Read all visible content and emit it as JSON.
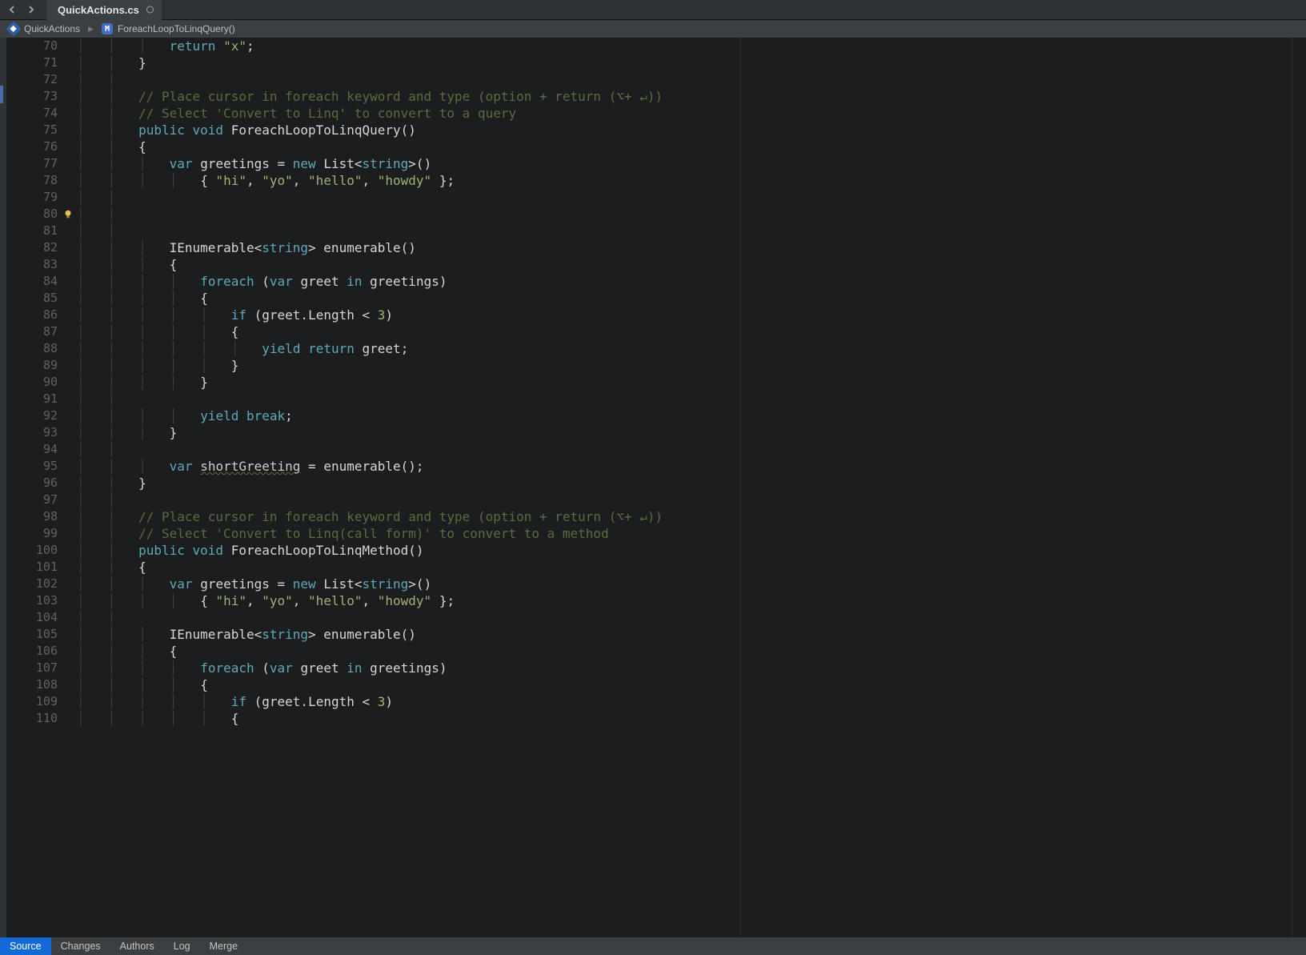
{
  "tab": {
    "title": "QuickActions.cs"
  },
  "breadcrumb": {
    "class": "QuickActions",
    "method": "ForeachLoopToLinqQuery()"
  },
  "lines": [
    {
      "n": 70,
      "indent": 12,
      "tokens": [
        [
          "kw",
          "return"
        ],
        [
          "punct",
          " "
        ],
        [
          "str",
          "\"x\""
        ],
        [
          "punct",
          ";"
        ]
      ]
    },
    {
      "n": 71,
      "indent": 8,
      "tokens": [
        [
          "punct",
          "}"
        ]
      ]
    },
    {
      "n": 72,
      "indent": 0,
      "tokens": []
    },
    {
      "n": 73,
      "indent": 8,
      "tokens": [
        [
          "cmt",
          "// Place cursor in foreach keyword and type (option + return (⌥+ ↵))"
        ]
      ]
    },
    {
      "n": 74,
      "indent": 8,
      "tokens": [
        [
          "cmt",
          "// Select 'Convert to Linq' to convert to a query"
        ]
      ]
    },
    {
      "n": 75,
      "indent": 8,
      "tokens": [
        [
          "kw",
          "public"
        ],
        [
          "punct",
          " "
        ],
        [
          "kw",
          "void"
        ],
        [
          "punct",
          " "
        ],
        [
          "method",
          "ForeachLoopToLinqQuery"
        ],
        [
          "punct",
          "()"
        ]
      ]
    },
    {
      "n": 76,
      "indent": 8,
      "tokens": [
        [
          "punct",
          "{"
        ]
      ]
    },
    {
      "n": 77,
      "indent": 12,
      "tokens": [
        [
          "kw",
          "var"
        ],
        [
          "punct",
          " "
        ],
        [
          "ident",
          "greetings = "
        ],
        [
          "kw",
          "new"
        ],
        [
          "punct",
          " "
        ],
        [
          "type",
          "List<"
        ],
        [
          "kw",
          "string"
        ],
        [
          "punct",
          ">()"
        ]
      ]
    },
    {
      "n": 78,
      "indent": 16,
      "tokens": [
        [
          "punct",
          "{ "
        ],
        [
          "str",
          "\"hi\""
        ],
        [
          "punct",
          ", "
        ],
        [
          "str",
          "\"yo\""
        ],
        [
          "punct",
          ", "
        ],
        [
          "str",
          "\"hello\""
        ],
        [
          "punct",
          ", "
        ],
        [
          "str",
          "\"howdy\""
        ],
        [
          "punct",
          " };"
        ]
      ]
    },
    {
      "n": 79,
      "indent": 0,
      "tokens": []
    },
    {
      "n": 80,
      "indent": 0,
      "tokens": [],
      "bulb": true
    },
    {
      "n": 81,
      "indent": 0,
      "tokens": []
    },
    {
      "n": 82,
      "indent": 12,
      "tokens": [
        [
          "type",
          "IEnumerable<"
        ],
        [
          "kw",
          "string"
        ],
        [
          "punct",
          "> "
        ],
        [
          "method",
          "enumerable"
        ],
        [
          "punct",
          "()"
        ]
      ]
    },
    {
      "n": 83,
      "indent": 12,
      "tokens": [
        [
          "punct",
          "{"
        ]
      ]
    },
    {
      "n": 84,
      "indent": 16,
      "tokens": [
        [
          "kw",
          "foreach"
        ],
        [
          "punct",
          " ("
        ],
        [
          "kw",
          "var"
        ],
        [
          "punct",
          " "
        ],
        [
          "ident",
          "greet "
        ],
        [
          "kw",
          "in"
        ],
        [
          "punct",
          " "
        ],
        [
          "ident",
          "greetings)"
        ]
      ]
    },
    {
      "n": 85,
      "indent": 16,
      "tokens": [
        [
          "punct",
          "{"
        ]
      ]
    },
    {
      "n": 86,
      "indent": 20,
      "tokens": [
        [
          "kw",
          "if"
        ],
        [
          "punct",
          " (greet.Length < "
        ],
        [
          "num",
          "3"
        ],
        [
          "punct",
          ")"
        ]
      ]
    },
    {
      "n": 87,
      "indent": 20,
      "tokens": [
        [
          "punct",
          "{"
        ]
      ]
    },
    {
      "n": 88,
      "indent": 24,
      "tokens": [
        [
          "kw",
          "yield"
        ],
        [
          "punct",
          " "
        ],
        [
          "kw",
          "return"
        ],
        [
          "punct",
          " greet;"
        ]
      ]
    },
    {
      "n": 89,
      "indent": 20,
      "tokens": [
        [
          "punct",
          "}"
        ]
      ]
    },
    {
      "n": 90,
      "indent": 16,
      "tokens": [
        [
          "punct",
          "}"
        ]
      ]
    },
    {
      "n": 91,
      "indent": 0,
      "tokens": []
    },
    {
      "n": 92,
      "indent": 16,
      "tokens": [
        [
          "kw",
          "yield"
        ],
        [
          "punct",
          " "
        ],
        [
          "kw",
          "break"
        ],
        [
          "punct",
          ";"
        ]
      ]
    },
    {
      "n": 93,
      "indent": 12,
      "tokens": [
        [
          "punct",
          "}"
        ]
      ]
    },
    {
      "n": 94,
      "indent": 0,
      "tokens": []
    },
    {
      "n": 95,
      "indent": 12,
      "tokens": [
        [
          "kw",
          "var"
        ],
        [
          "punct",
          " "
        ],
        [
          "underline",
          "shortGreeting"
        ],
        [
          "punct",
          " = enumerable();"
        ]
      ]
    },
    {
      "n": 96,
      "indent": 8,
      "tokens": [
        [
          "punct",
          "}"
        ]
      ]
    },
    {
      "n": 97,
      "indent": 0,
      "tokens": []
    },
    {
      "n": 98,
      "indent": 8,
      "tokens": [
        [
          "cmt",
          "// Place cursor in foreach keyword and type (option + return (⌥+ ↵))"
        ]
      ]
    },
    {
      "n": 99,
      "indent": 8,
      "tokens": [
        [
          "cmt",
          "// Select 'Convert to Linq(call form)' to convert to a method"
        ]
      ]
    },
    {
      "n": 100,
      "indent": 8,
      "tokens": [
        [
          "kw",
          "public"
        ],
        [
          "punct",
          " "
        ],
        [
          "kw",
          "void"
        ],
        [
          "punct",
          " "
        ],
        [
          "method",
          "ForeachLoopToLinqMethod"
        ],
        [
          "punct",
          "()"
        ]
      ]
    },
    {
      "n": 101,
      "indent": 8,
      "tokens": [
        [
          "punct",
          "{"
        ]
      ]
    },
    {
      "n": 102,
      "indent": 12,
      "tokens": [
        [
          "kw",
          "var"
        ],
        [
          "punct",
          " "
        ],
        [
          "ident",
          "greetings = "
        ],
        [
          "kw",
          "new"
        ],
        [
          "punct",
          " "
        ],
        [
          "type",
          "List<"
        ],
        [
          "kw",
          "string"
        ],
        [
          "punct",
          ">()"
        ]
      ]
    },
    {
      "n": 103,
      "indent": 16,
      "tokens": [
        [
          "punct",
          "{ "
        ],
        [
          "str",
          "\"hi\""
        ],
        [
          "punct",
          ", "
        ],
        [
          "str",
          "\"yo\""
        ],
        [
          "punct",
          ", "
        ],
        [
          "str",
          "\"hello\""
        ],
        [
          "punct",
          ", "
        ],
        [
          "str",
          "\"howdy\""
        ],
        [
          "punct",
          " };"
        ]
      ]
    },
    {
      "n": 104,
      "indent": 0,
      "tokens": []
    },
    {
      "n": 105,
      "indent": 12,
      "tokens": [
        [
          "type",
          "IEnumerable<"
        ],
        [
          "kw",
          "string"
        ],
        [
          "punct",
          "> "
        ],
        [
          "method",
          "enumerable"
        ],
        [
          "punct",
          "()"
        ]
      ]
    },
    {
      "n": 106,
      "indent": 12,
      "tokens": [
        [
          "punct",
          "{"
        ]
      ]
    },
    {
      "n": 107,
      "indent": 16,
      "tokens": [
        [
          "kw",
          "foreach"
        ],
        [
          "punct",
          " ("
        ],
        [
          "kw",
          "var"
        ],
        [
          "punct",
          " "
        ],
        [
          "ident",
          "greet "
        ],
        [
          "kw",
          "in"
        ],
        [
          "punct",
          " "
        ],
        [
          "ident",
          "greetings)"
        ]
      ]
    },
    {
      "n": 108,
      "indent": 16,
      "tokens": [
        [
          "punct",
          "{"
        ]
      ]
    },
    {
      "n": 109,
      "indent": 20,
      "tokens": [
        [
          "kw",
          "if"
        ],
        [
          "punct",
          " (greet.Length < "
        ],
        [
          "num",
          "3"
        ],
        [
          "punct",
          ")"
        ]
      ]
    },
    {
      "n": 110,
      "indent": 20,
      "tokens": [
        [
          "punct",
          "{"
        ]
      ]
    }
  ],
  "bottom_tabs": [
    "Source",
    "Changes",
    "Authors",
    "Log",
    "Merge"
  ],
  "active_bottom_tab": 0
}
